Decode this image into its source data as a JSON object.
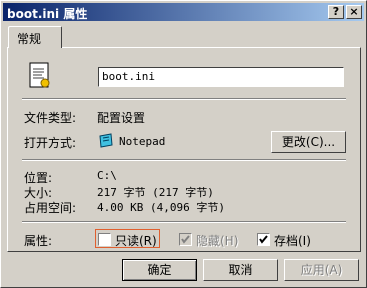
{
  "window": {
    "title": "boot.ini 属性",
    "help_button": "?",
    "close_button": "×"
  },
  "tabs": [
    {
      "label": "常规"
    }
  ],
  "file": {
    "name": "boot.ini"
  },
  "info": {
    "type_label": "文件类型:",
    "type_value": "配置设置",
    "open_with_label": "打开方式:",
    "open_with_value": "Notepad",
    "change_button": "更改(C)...",
    "location_label": "位置:",
    "location_value": "C:\\",
    "size_label": "大小:",
    "size_value": "217 字节 (217 字节)",
    "size_on_disk_label": "占用空间:",
    "size_on_disk_value": "4.00 KB (4,096 字节)"
  },
  "attributes": {
    "label": "属性:",
    "readonly": {
      "label": "只读(R)",
      "checked": false,
      "enabled": true
    },
    "hidden": {
      "label": "隐藏(H)",
      "checked": true,
      "enabled": false
    },
    "archive": {
      "label": "存档(I)",
      "checked": true,
      "enabled": true
    }
  },
  "buttons": {
    "ok": "确定",
    "cancel": "取消",
    "apply": "应用(A)"
  }
}
